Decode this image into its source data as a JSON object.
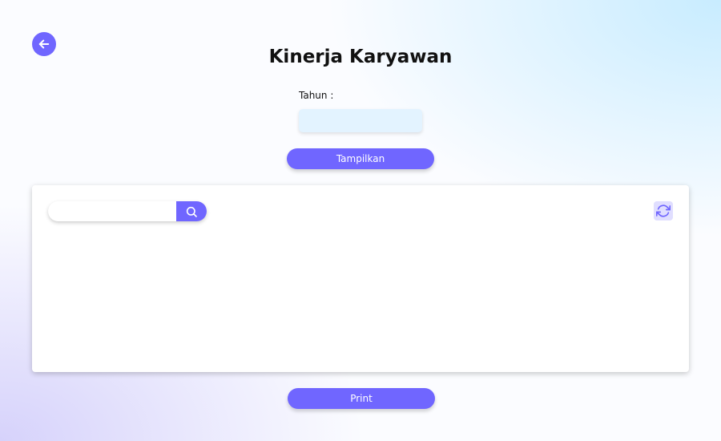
{
  "header": {
    "title": "Kinerja Karyawan",
    "back_icon": "arrow-left-icon"
  },
  "filter": {
    "tahun_label": "Tahun :",
    "tahun_value": "",
    "tahun_placeholder": "",
    "show_button_label": "Tampilkan"
  },
  "table_panel": {
    "search_placeholder": "",
    "search_value": "",
    "search_icon": "search-icon",
    "refresh_icon": "refresh-icon"
  },
  "footer": {
    "print_button_label": "Print"
  },
  "colors": {
    "accent": "#7066ff",
    "input_bg": "#e3f3ff",
    "refresh_bg": "#e0deff"
  }
}
